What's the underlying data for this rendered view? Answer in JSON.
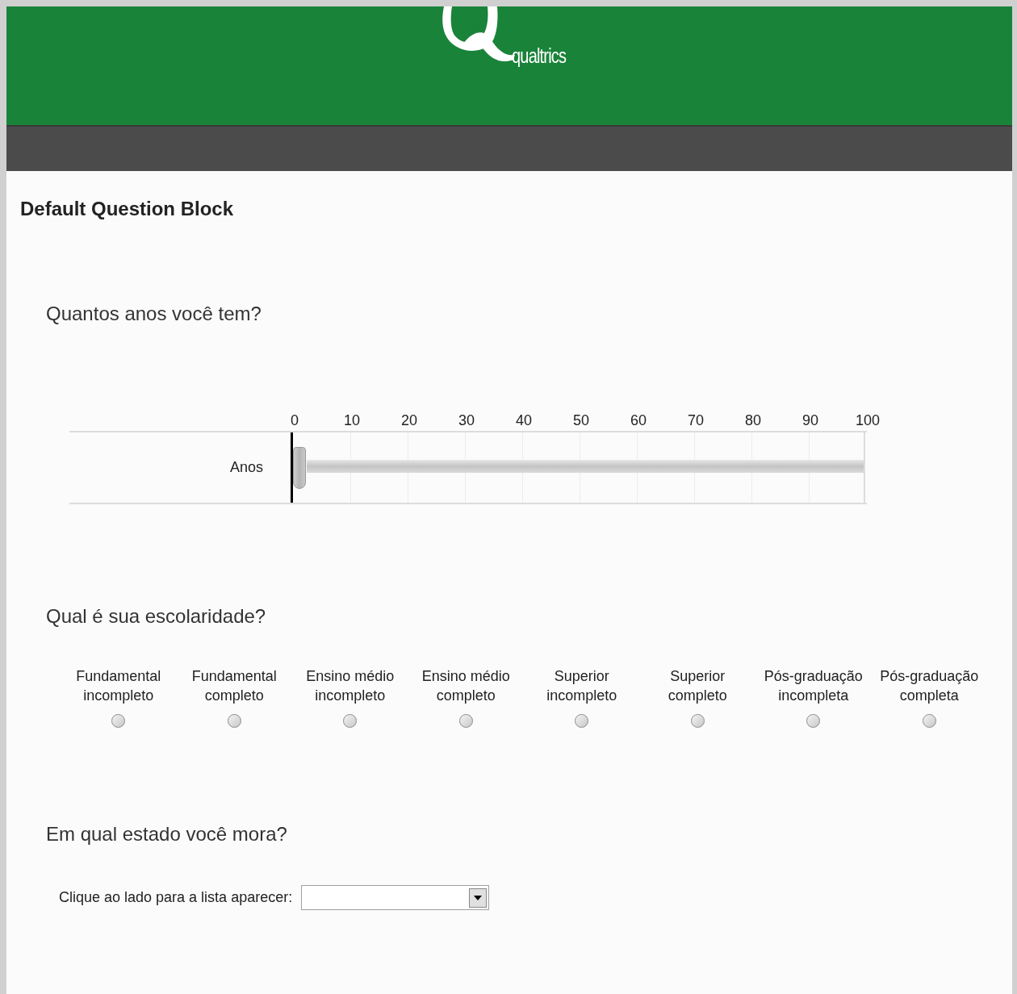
{
  "header": {
    "logo_text": "qualtrics"
  },
  "block_title": "Default Question Block",
  "questions": [
    {
      "kind": "slider",
      "text": "Quantos anos você tem?",
      "ticks": [
        "0",
        "10",
        "20",
        "30",
        "40",
        "50",
        "60",
        "70",
        "80",
        "90",
        "100"
      ],
      "rows": [
        {
          "label": "Anos",
          "level": 0
        }
      ]
    },
    {
      "kind": "radio",
      "text": "Qual é sua escolaridade?",
      "options": [
        {
          "label": "Fundamental incompleto",
          "selected": false
        },
        {
          "label": "Fundamental completo",
          "selected": false
        },
        {
          "label": "Ensino médio incompleto",
          "selected": false
        },
        {
          "label": "Ensino médio completo",
          "selected": false
        },
        {
          "label": "Superior incompleto",
          "selected": false
        },
        {
          "label": "Superior completo",
          "selected": false
        },
        {
          "label": "Pós-graduação incompleta",
          "selected": false
        },
        {
          "label": "Pós-graduação completa",
          "selected": false
        }
      ]
    },
    {
      "kind": "dropdown",
      "text": "Em qual estado você mora?",
      "label": "Clique ao lado para a lista aparecer:"
    }
  ]
}
